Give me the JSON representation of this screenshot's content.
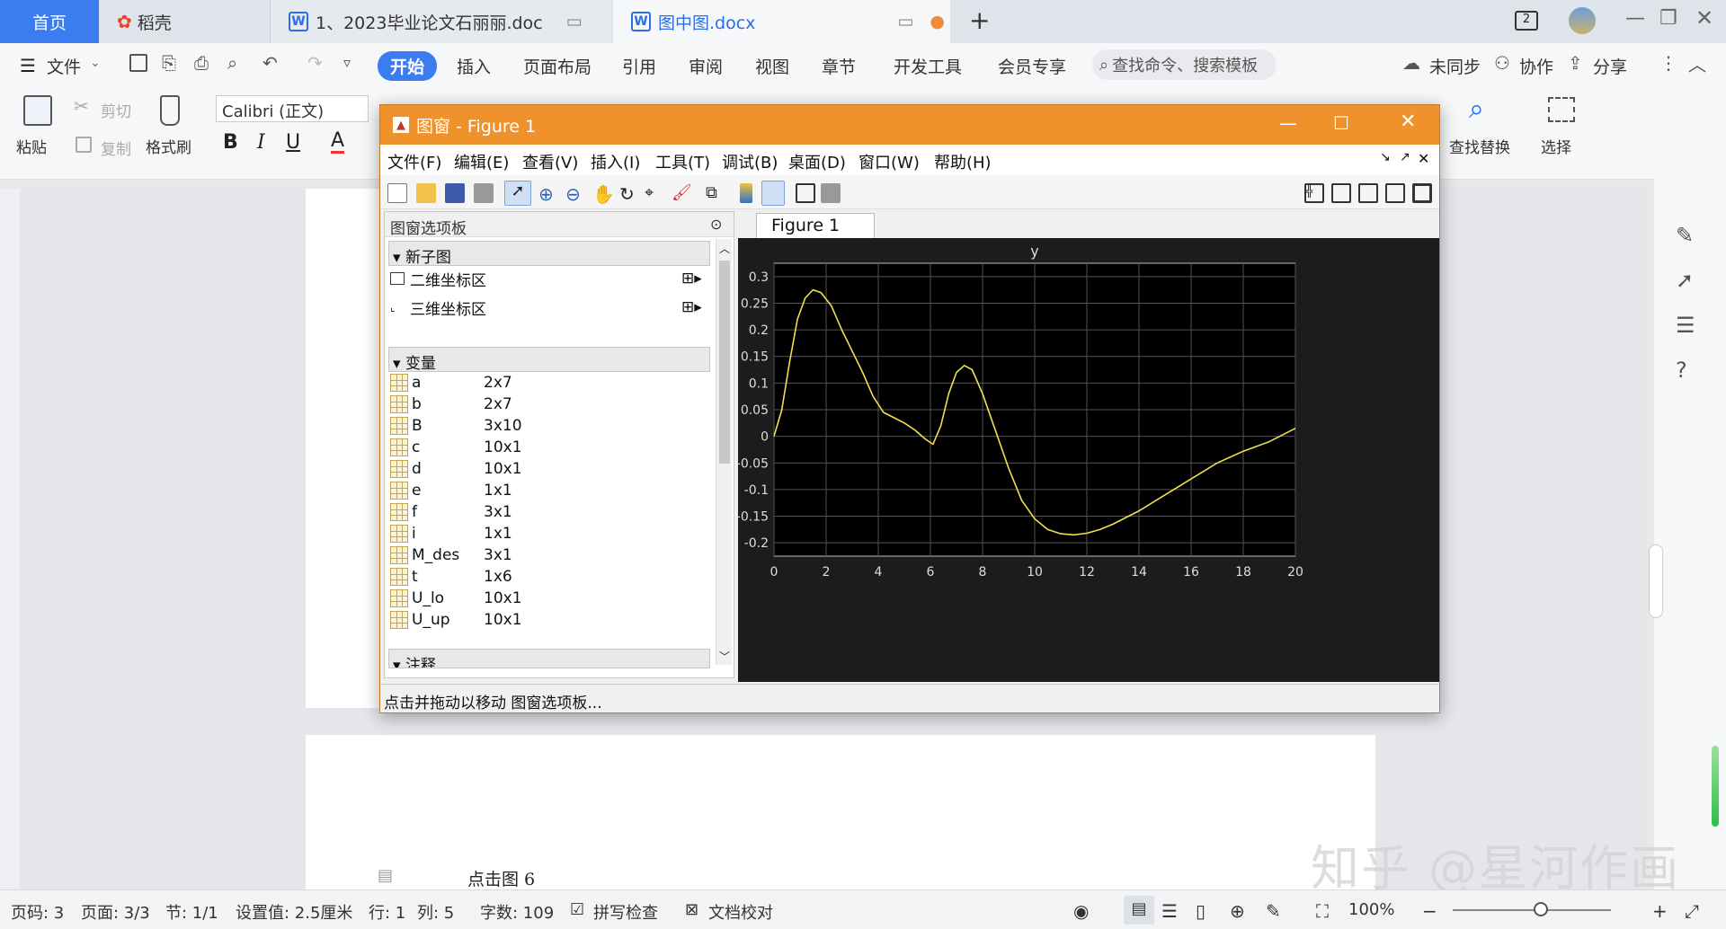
{
  "tabs": {
    "home": "首页",
    "daoke": "稻壳",
    "doc1": "1、2023毕业论文石丽丽.doc",
    "doc2": "图中图.docx"
  },
  "menubar": {
    "file": "文件",
    "start": "开始",
    "insert": "插入",
    "page_layout": "页面布局",
    "references": "引用",
    "review": "审阅",
    "view": "视图",
    "chapter": "章节",
    "dev_tools": "开发工具",
    "member": "会员专享",
    "search_placeholder": "查找命令、搜索模板",
    "unsynced": "未同步",
    "collab": "协作",
    "share": "分享"
  },
  "ribbon": {
    "paste": "粘贴",
    "cut": "剪切",
    "copy": "复制",
    "format_painter": "格式刷",
    "font_name": "Calibri (正文)",
    "find_replace": "查找替换",
    "select": "选择"
  },
  "document": {
    "caption": "点击图 6"
  },
  "figure": {
    "title": "图窗 - Figure 1",
    "menus": [
      "文件(F)",
      "编辑(E)",
      "查看(V)",
      "插入(I)",
      "工具(T)",
      "调试(B)",
      "桌面(D)",
      "窗口(W)",
      "帮助(H)"
    ],
    "palette_title": "图窗选项板",
    "section_new_subplot": "新子图",
    "axes_2d": "二维坐标区",
    "axes_3d": "三维坐标区",
    "section_variables": "变量",
    "section_annotations": "注释",
    "variables": [
      {
        "name": "a",
        "size": "2x7"
      },
      {
        "name": "b",
        "size": "2x7"
      },
      {
        "name": "B",
        "size": "3x10"
      },
      {
        "name": "c",
        "size": "10x1"
      },
      {
        "name": "d",
        "size": "10x1"
      },
      {
        "name": "e",
        "size": "1x1"
      },
      {
        "name": "f",
        "size": "3x1"
      },
      {
        "name": "i",
        "size": "1x1"
      },
      {
        "name": "M_des",
        "size": "3x1"
      },
      {
        "name": "t",
        "size": "1x6"
      },
      {
        "name": "U_lo",
        "size": "10x1"
      },
      {
        "name": "U_up",
        "size": "10x1"
      }
    ],
    "tab_label": "Figure 1",
    "status": "点击并拖动以移动 图窗选项板..."
  },
  "chart_data": {
    "type": "line",
    "title": "y",
    "xlabel": "",
    "ylabel": "",
    "xlim": [
      0,
      20
    ],
    "ylim": [
      -0.225,
      0.325
    ],
    "xticks": [
      0,
      2,
      4,
      6,
      8,
      10,
      12,
      14,
      16,
      18,
      20
    ],
    "yticks": [
      -0.2,
      -0.15,
      -0.1,
      -0.05,
      0,
      0.05,
      0.1,
      0.15,
      0.2,
      0.25,
      0.3
    ],
    "ytick_labels": [
      "-0.2",
      "-0.15",
      "-0.1",
      "-0.05",
      "0",
      "0.05",
      "0.1",
      "0.15",
      "0.2",
      "0.25",
      "0.3"
    ],
    "grid": true,
    "background": "#000000",
    "line_color": "#f0e050",
    "series": [
      {
        "x": [
          0,
          0.3,
          0.6,
          0.9,
          1.2,
          1.5,
          1.8,
          2.2,
          2.6,
          3.0,
          3.4,
          3.8,
          4.2,
          4.6,
          5.0,
          5.4,
          5.8,
          6.1,
          6.4,
          6.7,
          7.0,
          7.3,
          7.6,
          8.0,
          8.5,
          9.0,
          9.5,
          10.0,
          10.5,
          11.0,
          11.5,
          12.0,
          12.5,
          13.0,
          14.0,
          15.0,
          16.0,
          17.0,
          18.0,
          19.0,
          20.0
        ],
        "y": [
          0,
          0.05,
          0.14,
          0.22,
          0.26,
          0.275,
          0.27,
          0.245,
          0.2,
          0.16,
          0.12,
          0.075,
          0.045,
          0.035,
          0.025,
          0.012,
          -0.005,
          -0.015,
          0.02,
          0.08,
          0.12,
          0.133,
          0.125,
          0.08,
          0.01,
          -0.06,
          -0.12,
          -0.155,
          -0.175,
          -0.183,
          -0.185,
          -0.182,
          -0.175,
          -0.165,
          -0.14,
          -0.11,
          -0.08,
          -0.05,
          -0.028,
          -0.01,
          0.015
        ]
      }
    ]
  },
  "status": {
    "page_code": "页码: 3",
    "page": "页面: 3/3",
    "section": "节: 1/1",
    "setting": "设置值: 2.5厘米",
    "row": "行: 1",
    "col": "列: 5",
    "word_count": "字数: 109",
    "spell_check": "拼写检查",
    "doc_proof": "文档校对",
    "zoom": "100%"
  },
  "watermark": "知乎 @星河作画",
  "colors": {
    "accent": "#3b7cf0",
    "figure_title": "#f0922b"
  }
}
